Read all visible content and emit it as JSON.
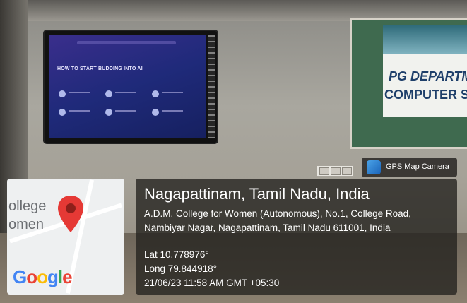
{
  "badge": {
    "icon": "map-camera-icon",
    "label": "GPS Map Camera"
  },
  "location": {
    "title": "Nagapattinam, Tamil Nadu, India",
    "address": "A.D.M. College for Women (Autonomous), No.1, College Road, Nambiyar Nagar, Nagapattinam, Tamil Nadu 611001, India",
    "lat": "Lat 10.778976°",
    "long": "Long 79.844918°",
    "datetime": "21/06/23 11:58 AM GMT +05:30"
  },
  "map": {
    "word1": "ollege",
    "word2": "omen",
    "logo": "Google",
    "logo_colors": [
      "#4285F4",
      "#EA4335",
      "#FBBC05",
      "#4285F4",
      "#34A853",
      "#EA4335"
    ],
    "pin_color": "#E53935"
  },
  "tv": {
    "slide_title": "HOW TO START  BUDDING INTO AI"
  },
  "board": {
    "line1": "PG DEPARTM",
    "line2": "COMPUTER S"
  }
}
